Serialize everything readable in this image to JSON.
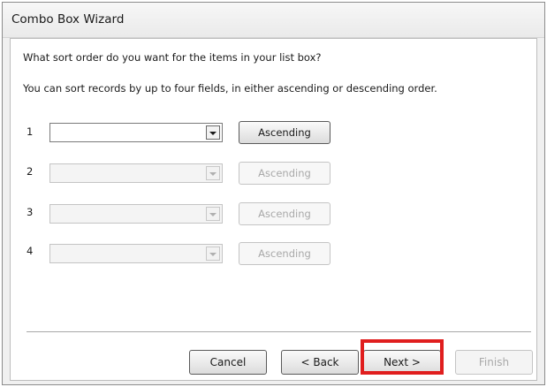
{
  "window": {
    "title": "Combo Box Wizard"
  },
  "prompt": {
    "question": "What sort order do you want for the items in your list box?",
    "instructions": "You can sort records by up to four fields, in either ascending or descending order."
  },
  "sort_rows": [
    {
      "number": "1",
      "field_value": "",
      "order_label": "Ascending",
      "enabled": true
    },
    {
      "number": "2",
      "field_value": "",
      "order_label": "Ascending",
      "enabled": false
    },
    {
      "number": "3",
      "field_value": "",
      "order_label": "Ascending",
      "enabled": false
    },
    {
      "number": "4",
      "field_value": "",
      "order_label": "Ascending",
      "enabled": false
    }
  ],
  "footer": {
    "cancel_label": "Cancel",
    "back_label": "< Back",
    "next_label": "Next >",
    "finish_label": "Finish",
    "finish_enabled": false,
    "highlighted_button": "Next >",
    "highlight_color": "#e01e1e"
  }
}
